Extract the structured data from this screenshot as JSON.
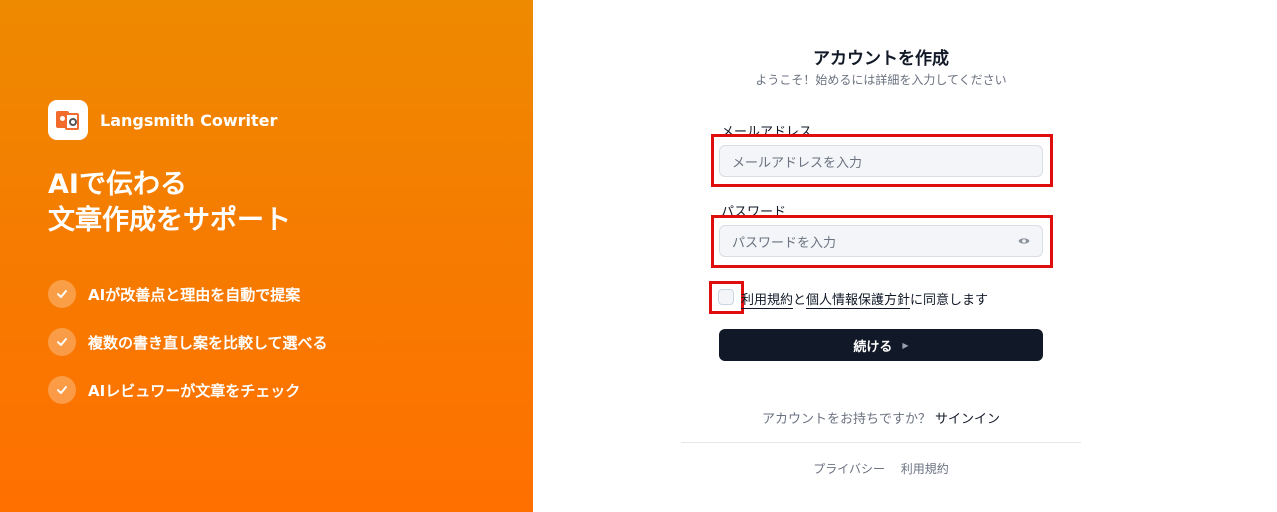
{
  "hero": {
    "brand_name": "Langsmith Cowriter",
    "headline_line1": "AIで伝わる",
    "headline_line2": "文章作成をサポート",
    "features": [
      "AIが改善点と理由を自動で提案",
      "複数の書き直し案を比較して選べる",
      "AIレビュワーが文章をチェック"
    ],
    "colors": {
      "gradient_top": "#ee8a00",
      "gradient_bottom": "#ff7000"
    }
  },
  "form": {
    "title": "アカウントを作成",
    "subtitle": "ようこそ！始めるには詳細を入力してください",
    "email_label": "メールアドレス",
    "email_placeholder": "メールアドレスを入力",
    "password_label": "パスワード",
    "password_placeholder": "パスワードを入力",
    "agree_terms_link": "利用規約",
    "agree_and": "と",
    "agree_privacy_link": "個人情報保護方針",
    "agree_suffix": "に同意します",
    "terms_checked": false,
    "continue_label": "続ける",
    "has_account_text": "アカウントをお持ちですか？",
    "signin_link": "サインイン",
    "highlight_color": "#e00d0d",
    "button_color": "#111827"
  },
  "footer": {
    "privacy": "プライバシー",
    "terms": "利用規約"
  }
}
